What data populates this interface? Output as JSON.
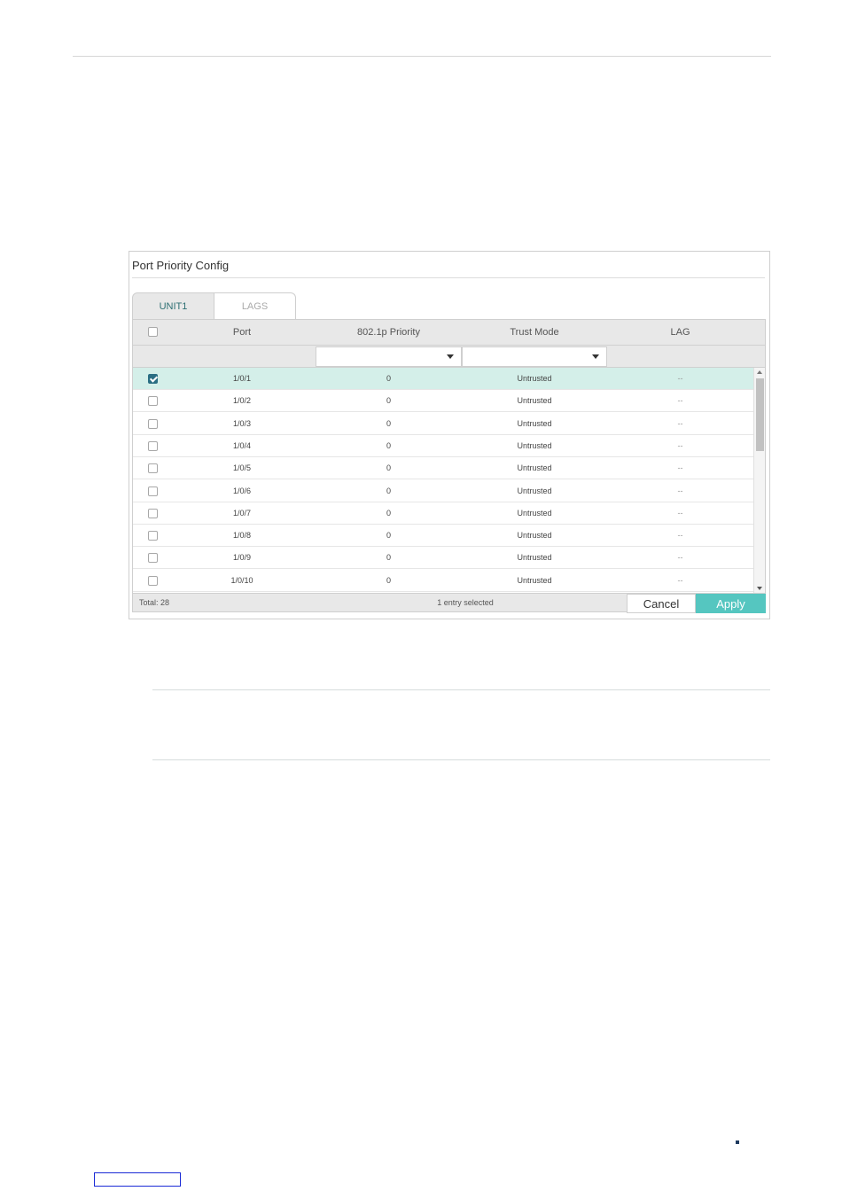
{
  "panel": {
    "title": "Port Priority Config"
  },
  "tabs": [
    {
      "label": "UNIT1",
      "active": true
    },
    {
      "label": "LAGS",
      "active": false
    }
  ],
  "columns": {
    "port": "Port",
    "priority": "802.1p Priority",
    "trust": "Trust Mode",
    "lag": "LAG"
  },
  "rows": [
    {
      "port": "1/0/1",
      "priority": "0",
      "trust": "Untrusted",
      "lag": "--",
      "checked": true
    },
    {
      "port": "1/0/2",
      "priority": "0",
      "trust": "Untrusted",
      "lag": "--",
      "checked": false
    },
    {
      "port": "1/0/3",
      "priority": "0",
      "trust": "Untrusted",
      "lag": "--",
      "checked": false
    },
    {
      "port": "1/0/4",
      "priority": "0",
      "trust": "Untrusted",
      "lag": "--",
      "checked": false
    },
    {
      "port": "1/0/5",
      "priority": "0",
      "trust": "Untrusted",
      "lag": "--",
      "checked": false
    },
    {
      "port": "1/0/6",
      "priority": "0",
      "trust": "Untrusted",
      "lag": "--",
      "checked": false
    },
    {
      "port": "1/0/7",
      "priority": "0",
      "trust": "Untrusted",
      "lag": "--",
      "checked": false
    },
    {
      "port": "1/0/8",
      "priority": "0",
      "trust": "Untrusted",
      "lag": "--",
      "checked": false
    },
    {
      "port": "1/0/9",
      "priority": "0",
      "trust": "Untrusted",
      "lag": "--",
      "checked": false
    },
    {
      "port": "1/0/10",
      "priority": "0",
      "trust": "Untrusted",
      "lag": "--",
      "checked": false
    }
  ],
  "footer": {
    "total": "Total: 28",
    "selected": "1 entry selected",
    "cancel": "Cancel",
    "apply": "Apply"
  },
  "colors": {
    "accent": "#55c6c0",
    "checkbox": "#2a6e83",
    "selected_row": "#d4efe9"
  }
}
